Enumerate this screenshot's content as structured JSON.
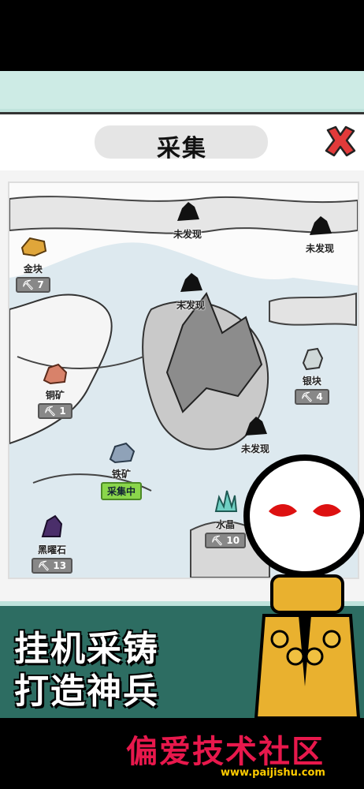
{
  "header": {
    "title": "采集"
  },
  "map": {
    "nodes": [
      {
        "id": "gold",
        "label": "金块",
        "count": "7",
        "color": "#e0a63a",
        "state": "tool"
      },
      {
        "id": "unknown1",
        "label": "未发现",
        "state": "locked"
      },
      {
        "id": "unknown2",
        "label": "未发现",
        "state": "locked"
      },
      {
        "id": "unknown3",
        "label": "未发现",
        "state": "locked"
      },
      {
        "id": "silver",
        "label": "银块",
        "count": "4",
        "color": "#cfd8d8",
        "state": "tool"
      },
      {
        "id": "copper",
        "label": "铜矿",
        "count": "1",
        "color": "#d8826a",
        "state": "tool"
      },
      {
        "id": "unknown4",
        "label": "未发现",
        "state": "locked"
      },
      {
        "id": "iron",
        "label": "铁矿",
        "status": "采集中",
        "color": "#8fa2b8",
        "state": "active"
      },
      {
        "id": "crystal",
        "label": "水晶",
        "count": "10",
        "color": "#6fd0c4",
        "state": "tool"
      },
      {
        "id": "obsidian",
        "label": "黑曜石",
        "count": "13",
        "color": "#4a2e6a",
        "state": "tool"
      }
    ]
  },
  "banner": {
    "line1": "挂机采铸",
    "line2": "打造神兵"
  },
  "watermark": {
    "title": "偏爱技术社区",
    "url": "www.paijishu.com"
  },
  "colors": {
    "accent": "#e23a3a",
    "active": "#8ad64b",
    "teal": "#2d6d62"
  }
}
